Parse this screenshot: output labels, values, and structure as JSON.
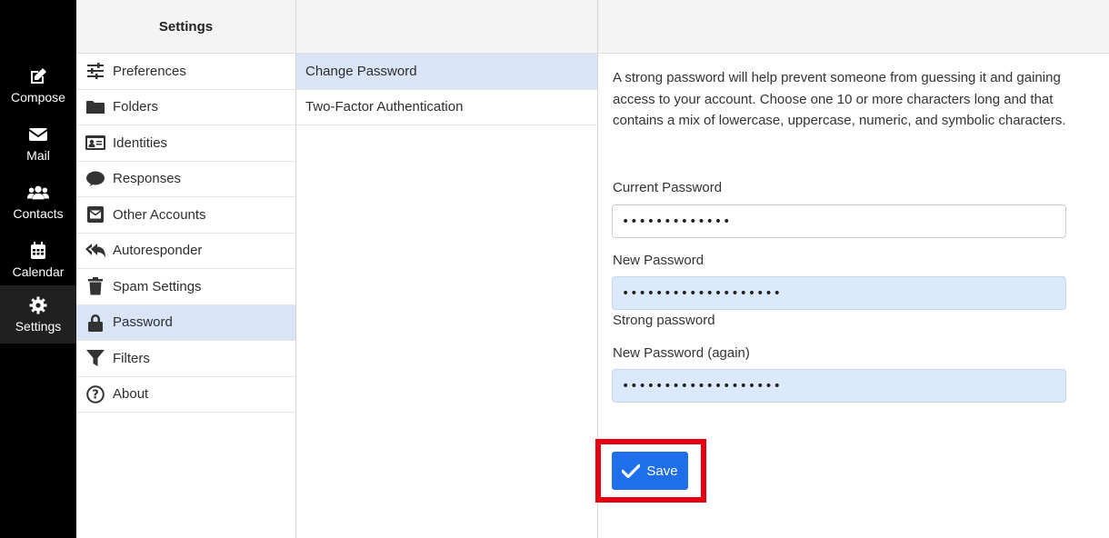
{
  "nav": {
    "compose": "Compose",
    "mail": "Mail",
    "contacts": "Contacts",
    "calendar": "Calendar",
    "settings": "Settings"
  },
  "settings_list": {
    "title": "Settings",
    "items": [
      {
        "label": "Preferences",
        "icon": "sliders-icon"
      },
      {
        "label": "Folders",
        "icon": "folder-icon"
      },
      {
        "label": "Identities",
        "icon": "id-card-icon"
      },
      {
        "label": "Responses",
        "icon": "comment-icon"
      },
      {
        "label": "Other Accounts",
        "icon": "envelope-square-icon"
      },
      {
        "label": "Autoresponder",
        "icon": "reply-all-icon"
      },
      {
        "label": "Spam Settings",
        "icon": "trash-icon"
      },
      {
        "label": "Password",
        "icon": "lock-icon"
      },
      {
        "label": "Filters",
        "icon": "filter-icon"
      },
      {
        "label": "About",
        "icon": "question-circle-icon"
      }
    ]
  },
  "password_menu": {
    "items": [
      "Change Password",
      "Two-Factor Authentication"
    ]
  },
  "form": {
    "description": "A strong password will help prevent someone from guessing it and gaining access to your account. Choose one 10 or more characters long and that contains a mix of lowercase, uppercase, numeric, and symbolic characters.",
    "current_label": "Current Password",
    "current_value": "•••••••••••••",
    "new_label": "New Password",
    "new_value": "•••••••••••••••••••",
    "strength": "Strong password",
    "again_label": "New Password (again)",
    "again_value": "•••••••••••••••••••",
    "save": "Save"
  },
  "colors": {
    "accent": "#1f6feb",
    "highlight": "#e60012",
    "selected_row": "#d9e5f7"
  }
}
